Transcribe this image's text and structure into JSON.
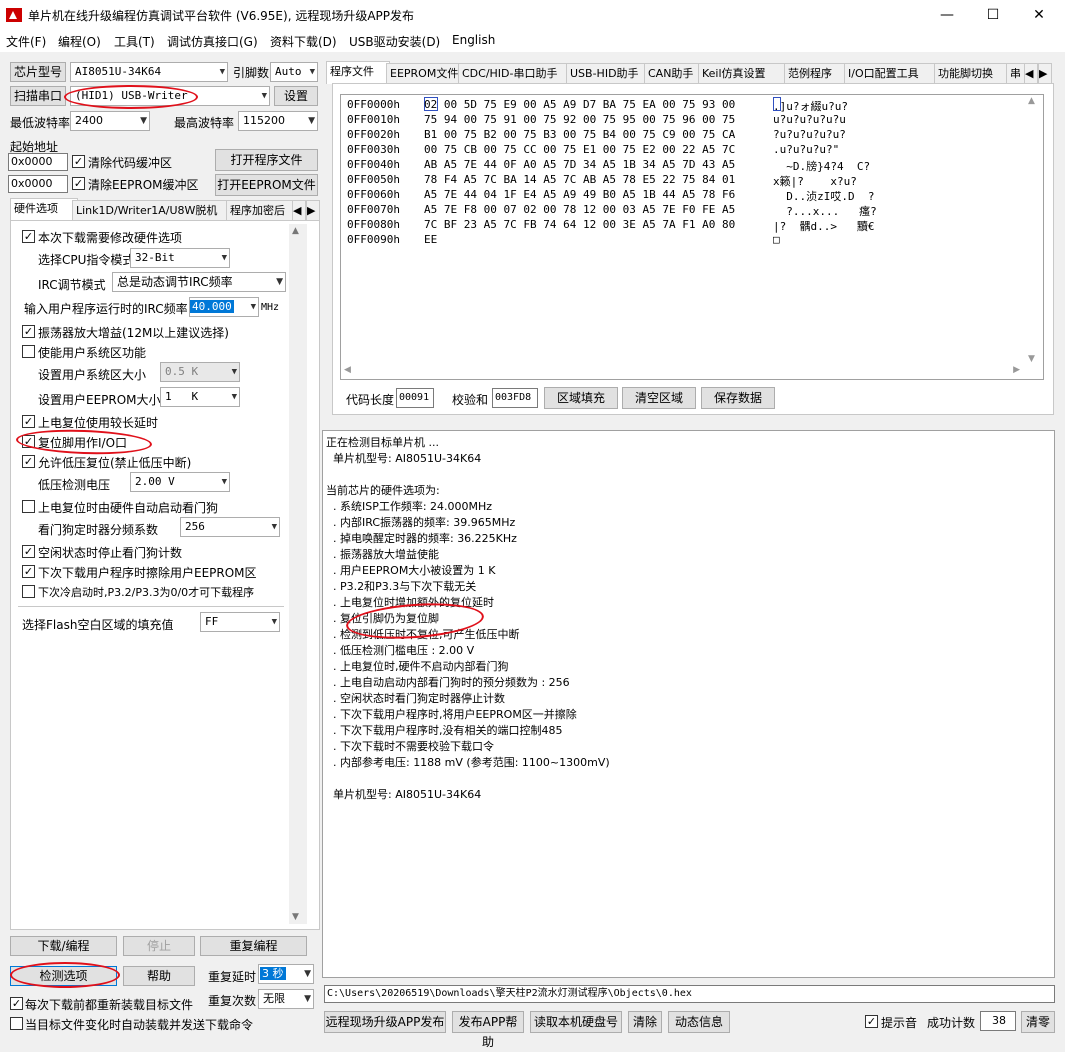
{
  "window": {
    "title": "单片机在线升级编程仿真调试平台软件 (V6.95E), 远程现场升级APP发布",
    "minimize": "—",
    "maximize": "☐",
    "close": "✕"
  },
  "menu": [
    "文件(F)",
    "编程(O)",
    "工具(T)",
    "调试仿真接口(G)",
    "资料下载(D)",
    "USB驱动安装(D)",
    "English"
  ],
  "left": {
    "chip_btn": "芯片型号",
    "chip_value": "AI8051U-34K64",
    "pins_label": "引脚数",
    "pins_value": "Auto",
    "scan_btn": "扫描串口",
    "port_value": "(HID1) USB-Writer",
    "settings_btn": "设置",
    "min_baud_label": "最低波特率",
    "min_baud": "2400",
    "max_baud_label": "最高波特率",
    "max_baud": "115200",
    "start_addr_label": "起始地址",
    "code_addr": "0x0000",
    "clear_code": "清除代码缓冲区",
    "open_prog": "打开程序文件",
    "eeprom_addr": "0x0000",
    "clear_eeprom": "清除EEPROM缓冲区",
    "open_eeprom": "打开EEPROM文件",
    "tabs": [
      "硬件选项",
      "Link1D/Writer1A/U8W脱机",
      "程序加密后"
    ],
    "options": {
      "modify_hw": "本次下载需要修改硬件选项",
      "cpu_label": "选择CPU指令模式",
      "cpu_value": "32-Bit",
      "irc_mode_label": "IRC调节模式",
      "irc_mode_value": "总是动态调节IRC频率",
      "irc_freq_label": "输入用户程序运行时的IRC频率",
      "irc_freq_value": "40.000",
      "irc_unit": "MHz",
      "osc_gain": "振荡器放大增益(12M以上建议选择)",
      "user_sys": "使能用户系统区功能",
      "sys_size_label": "设置用户系统区大小",
      "sys_size_value": "0.5 K",
      "eeprom_size_label": "设置用户EEPROM大小",
      "eeprom_size_value": "1   K",
      "long_delay": "上电复位使用较长延时",
      "reset_io": "复位脚用作I/O口",
      "lvr": "允许低压复位(禁止低压中断)",
      "lvd_label": "低压检测电压",
      "lvd_value": "2.00 V",
      "wdt_auto": "上电复位时由硬件自动启动看门狗",
      "wdt_div_label": "看门狗定时器分频系数",
      "wdt_div_value": "256",
      "idle_wdt": "空闲状态时停止看门狗计数",
      "erase_eeprom": "下次下载用户程序时擦除用户EEPROM区",
      "p32_p33": "下次冷启动时,P3.2/P3.3为0/0才可下载程序",
      "fill_label": "选择Flash空白区域的填充值",
      "fill_value": "FF"
    },
    "download_btn": "下载/编程",
    "stop_btn": "停止",
    "repeat_btn": "重复编程",
    "detect_btn": "检测选项",
    "help_btn": "帮助",
    "repeat_delay_label": "重复延时",
    "repeat_delay": "3 秒",
    "repeat_count_label": "重复次数",
    "repeat_count": "无限",
    "reload": "每次下载前都重新装载目标文件",
    "auto_send": "当目标文件变化时自动装载并发送下载命令"
  },
  "right": {
    "tabs": [
      "程序文件",
      "EEPROM文件",
      "CDC/HID-串口助手",
      "USB-HID助手",
      "CAN助手",
      "Keil仿真设置",
      "范例程序",
      "I/O口配置工具",
      "功能脚切换",
      "串"
    ],
    "hex_rows": [
      {
        "addr": "0FF0000h",
        "bytes": "02 00 5D 75 E9 00 A5 A9 D7 BA 75 EA 00 75 93 00",
        "ascii": ".]u?ォ綴u?u?"
      },
      {
        "addr": "0FF0010h",
        "bytes": "75 94 00 75 91 00 75 92 00 75 95 00 75 96 00 75",
        "ascii": "u?u?u?u?u?u"
      },
      {
        "addr": "0FF0020h",
        "bytes": "B1 00 75 B2 00 75 B3 00 75 B4 00 75 C9 00 75 CA",
        "ascii": "?u?u?u?u?u?"
      },
      {
        "addr": "0FF0030h",
        "bytes": "00 75 CB 00 75 CC 00 75 E1 00 75 E2 00 22 A5 7C",
        "ascii": ".u?u?u?u?\""
      },
      {
        "addr": "0FF0040h",
        "bytes": "AB A5 7E 44 0F A0 A5 7D 34 A5 1B 34 A5 7D 43 A5",
        "ascii": "  ~D.牓}4?4  C?"
      },
      {
        "addr": "0FF0050h",
        "bytes": "78 F4 A5 7C BA 14 A5 7C AB A5 78 E5 22 75 84 01",
        "ascii": "x籁|?    x?u?"
      },
      {
        "addr": "0FF0060h",
        "bytes": "A5 7E 44 04 1F E4 A5 A9 49 B0 A5 1B 44 A5 78 F6",
        "ascii": "  D..浈zI哎.D  ?"
      },
      {
        "addr": "0FF0070h",
        "bytes": "A5 7E F8 00 07 02 00 78 12 00 03 A5 7E F0 FE A5",
        "ascii": "  ?...x...   瘙?"
      },
      {
        "addr": "0FF0080h",
        "bytes": "7C BF 23 A5 7C FB 74 64 12 00 3E A5 7A F1 A0 80",
        "ascii": "|?  髃d..>   黷€"
      },
      {
        "addr": "0FF0090h",
        "bytes": "EE",
        "ascii": "□"
      }
    ],
    "code_len_label": "代码长度",
    "code_len": "00091",
    "checksum_label": "校验和",
    "checksum": "003FD8",
    "fill_btn": "区域填充",
    "clear_btn": "清空区域",
    "save_btn": "保存数据",
    "log": [
      "正在检测目标单片机 ...",
      "  单片机型号: AI8051U-34K64",
      "",
      "当前芯片的硬件选项为:",
      "  . 系统ISP工作频率: 24.000MHz",
      "  . 内部IRC振荡器的频率: 39.965MHz",
      "  . 掉电唤醒定时器的频率: 36.225KHz",
      "  . 振荡器放大增益使能",
      "  . 用户EEPROM大小被设置为 1 K",
      "  . P3.2和P3.3与下次下载无关",
      "  . 上电复位时增加额外的复位延时",
      "  . 复位引脚仍为复位脚",
      "  . 检测到低压时不复位,可产生低压中断",
      "  . 低压检测门槛电压 : 2.00 V",
      "  . 上电复位时,硬件不启动内部看门狗",
      "  . 上电自动启动内部看门狗时的预分频数为 : 256",
      "  . 空闲状态时看门狗定时器停止计数",
      "  . 下次下载用户程序时,将用户EEPROM区一并擦除",
      "  . 下次下载用户程序时,没有相关的端口控制485",
      "  . 下次下载时不需要校验下载口令",
      "  . 内部参考电压: 1188 mV (参考范围: 1100~1300mV)",
      "",
      "  单片机型号: AI8051U-34K64"
    ],
    "path": "C:\\Users\\20206519\\Downloads\\擎天柱P2流水灯测试程序\\Objects\\0.hex",
    "bottom": {
      "remote_btn": "远程现场升级APP发布",
      "publish_btn": "发布APP帮助",
      "read_disk_btn": "读取本机硬盘号",
      "clear_btn": "清除",
      "dynamic_btn": "动态信息",
      "sound_label": "提示音",
      "success_label": "成功计数",
      "success_count": "38",
      "reset_btn": "清零"
    }
  }
}
